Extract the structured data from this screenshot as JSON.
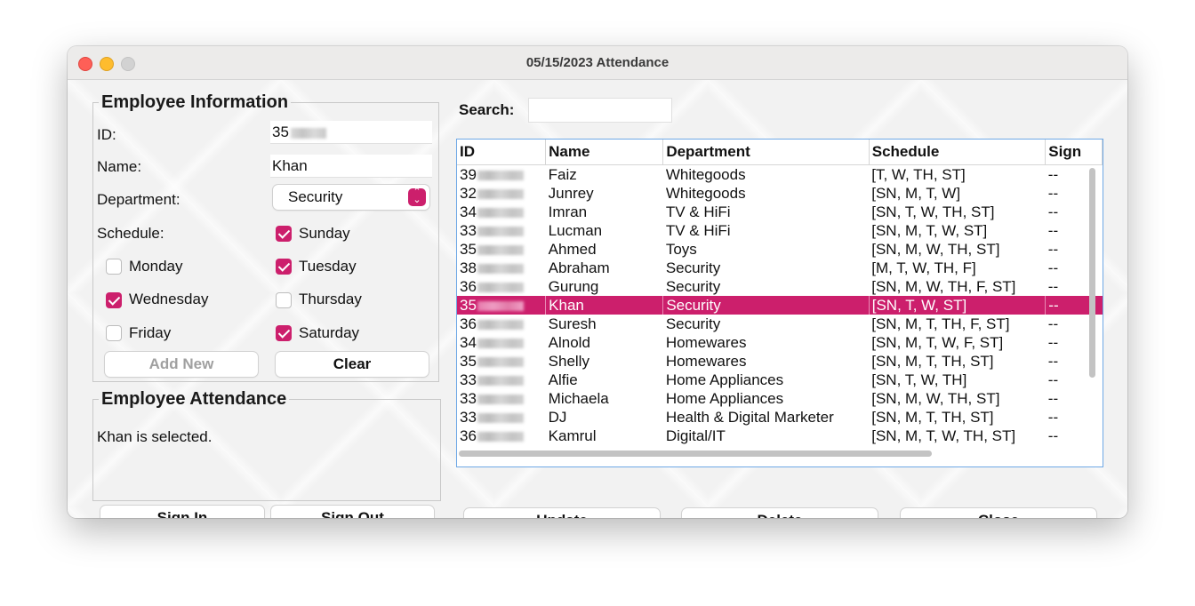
{
  "window": {
    "title": "05/15/2023 Attendance"
  },
  "employee_info": {
    "legend": "Employee Information",
    "id_label": "ID:",
    "id_value": "35",
    "name_label": "Name:",
    "name_value": "Khan",
    "department_label": "Department:",
    "department_value": "Security",
    "schedule_label": "Schedule:",
    "days": [
      {
        "label": "Sunday",
        "checked": true
      },
      {
        "label": "Monday",
        "checked": false
      },
      {
        "label": "Tuesday",
        "checked": true
      },
      {
        "label": "Wednesday",
        "checked": true
      },
      {
        "label": "Thursday",
        "checked": false
      },
      {
        "label": "Friday",
        "checked": false
      },
      {
        "label": "Saturday",
        "checked": true
      }
    ],
    "add_new_label": "Add New",
    "clear_label": "Clear"
  },
  "attendance": {
    "legend": "Employee Attendance",
    "status_text": "Khan is selected.",
    "sign_in_label": "Sign In",
    "sign_out_label": "Sign Out"
  },
  "search": {
    "label": "Search:",
    "value": ""
  },
  "table": {
    "columns": [
      "ID",
      "Name",
      "Department",
      "Schedule",
      "Sign"
    ],
    "rows": [
      {
        "id": "39",
        "name": "Faiz",
        "department": "Whitegoods",
        "schedule": "[T, W, TH, ST]",
        "sign": "--",
        "selected": false
      },
      {
        "id": "32",
        "name": "Junrey",
        "department": "Whitegoods",
        "schedule": "[SN, M, T, W]",
        "sign": "--",
        "selected": false
      },
      {
        "id": "34",
        "name": "Imran",
        "department": "TV & HiFi",
        "schedule": "[SN, T, W, TH, ST]",
        "sign": "--",
        "selected": false
      },
      {
        "id": "33",
        "name": "Lucman",
        "department": "TV & HiFi",
        "schedule": "[SN, M, T, W, ST]",
        "sign": "--",
        "selected": false
      },
      {
        "id": "35",
        "name": "Ahmed",
        "department": "Toys",
        "schedule": "[SN, M, W, TH, ST]",
        "sign": "--",
        "selected": false
      },
      {
        "id": "38",
        "name": "Abraham",
        "department": "Security",
        "schedule": "[M, T, W, TH, F]",
        "sign": "--",
        "selected": false
      },
      {
        "id": "36",
        "name": "Gurung",
        "department": "Security",
        "schedule": "[SN, M, W, TH, F, ST]",
        "sign": "--",
        "selected": false
      },
      {
        "id": "35",
        "name": "Khan",
        "department": "Security",
        "schedule": "[SN, T, W, ST]",
        "sign": "--",
        "selected": true
      },
      {
        "id": "36",
        "name": "Suresh",
        "department": "Security",
        "schedule": "[SN, M, T, TH, F, ST]",
        "sign": "--",
        "selected": false
      },
      {
        "id": "34",
        "name": "Alnold",
        "department": "Homewares",
        "schedule": "[SN, M, T, W, F, ST]",
        "sign": "--",
        "selected": false
      },
      {
        "id": "35",
        "name": "Shelly",
        "department": "Homewares",
        "schedule": "[SN, M, T, TH, ST]",
        "sign": "--",
        "selected": false
      },
      {
        "id": "33",
        "name": "Alfie",
        "department": "Home Appliances",
        "schedule": "[SN, T, W, TH]",
        "sign": "--",
        "selected": false
      },
      {
        "id": "33",
        "name": "Michaela",
        "department": "Home Appliances",
        "schedule": "[SN, M, W, TH, ST]",
        "sign": "--",
        "selected": false
      },
      {
        "id": "33",
        "name": "DJ",
        "department": "Health & Digital Marketer",
        "schedule": "[SN, M, T, TH, ST]",
        "sign": "--",
        "selected": false
      },
      {
        "id": "36",
        "name": "Kamrul",
        "department": "Digital/IT",
        "schedule": "[SN, M, T, W, TH, ST]",
        "sign": "--",
        "selected": false
      }
    ]
  },
  "actions": {
    "update_label": "Update",
    "delete_label": "Delete",
    "close_label": "Close"
  },
  "colors": {
    "accent": "#cc1f6c",
    "focus_border": "#6ea8e6"
  }
}
